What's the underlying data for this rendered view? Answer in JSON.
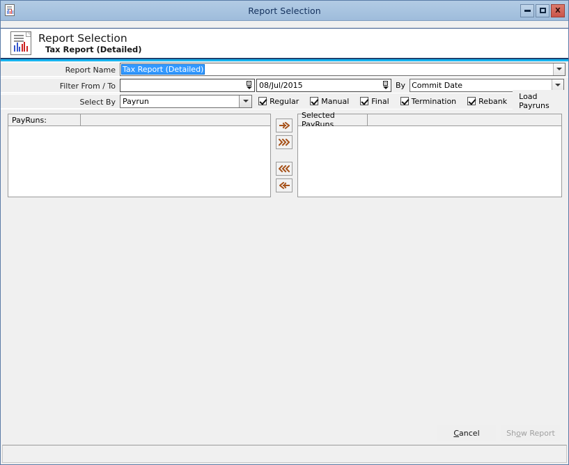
{
  "window": {
    "title": "Report Selection",
    "icon": "report-document-icon",
    "buttons": {
      "minimize": "minimize-icon",
      "maximize": "maximize-icon",
      "close": "X"
    }
  },
  "header": {
    "icon": "report-document-icon",
    "title": "Report Selection",
    "subtitle": "Tax Report (Detailed)",
    "accent_color": "#16b4f0"
  },
  "form": {
    "report_name": {
      "label": "Report Name",
      "value": "Tax Report (Detailed)",
      "selected": true,
      "selection_color": "#3399ff"
    },
    "filter": {
      "label": "Filter From / To",
      "from_value": "",
      "from_placeholder": "",
      "to_value": "08/Jul/2015",
      "by_label": "By",
      "by_value": "Commit Date"
    },
    "select_by": {
      "label": "Select By",
      "value": "Payrun"
    },
    "checkboxes": [
      {
        "label": "Regular",
        "checked": true
      },
      {
        "label": "Manual",
        "checked": true
      },
      {
        "label": "Final",
        "checked": true
      },
      {
        "label": "Termination",
        "checked": true
      },
      {
        "label": "Rebank",
        "checked": true
      }
    ],
    "load_button": "Load Payruns"
  },
  "lists": {
    "available": {
      "header": "PayRuns:",
      "header_second": "",
      "rows": []
    },
    "selected": {
      "header": "Selected PayRuns",
      "header_second": "",
      "rows": []
    },
    "transfer_buttons": [
      {
        "name": "move-right-button",
        "icon": "arrow-right-icon"
      },
      {
        "name": "move-all-right-button",
        "icon": "double-arrow-right-icon"
      },
      {
        "name": "move-all-left-button",
        "icon": "double-arrow-left-icon"
      },
      {
        "name": "move-left-button",
        "icon": "arrow-left-icon"
      }
    ],
    "arrow_color": "#a6521a"
  },
  "footer": {
    "cancel": {
      "pre": "",
      "mnemonic": "C",
      "post": "ancel",
      "disabled": false
    },
    "show_report": {
      "pre": "Sh",
      "mnemonic": "o",
      "post": "w Report",
      "disabled": true
    }
  },
  "statusbar": {
    "text": ""
  }
}
